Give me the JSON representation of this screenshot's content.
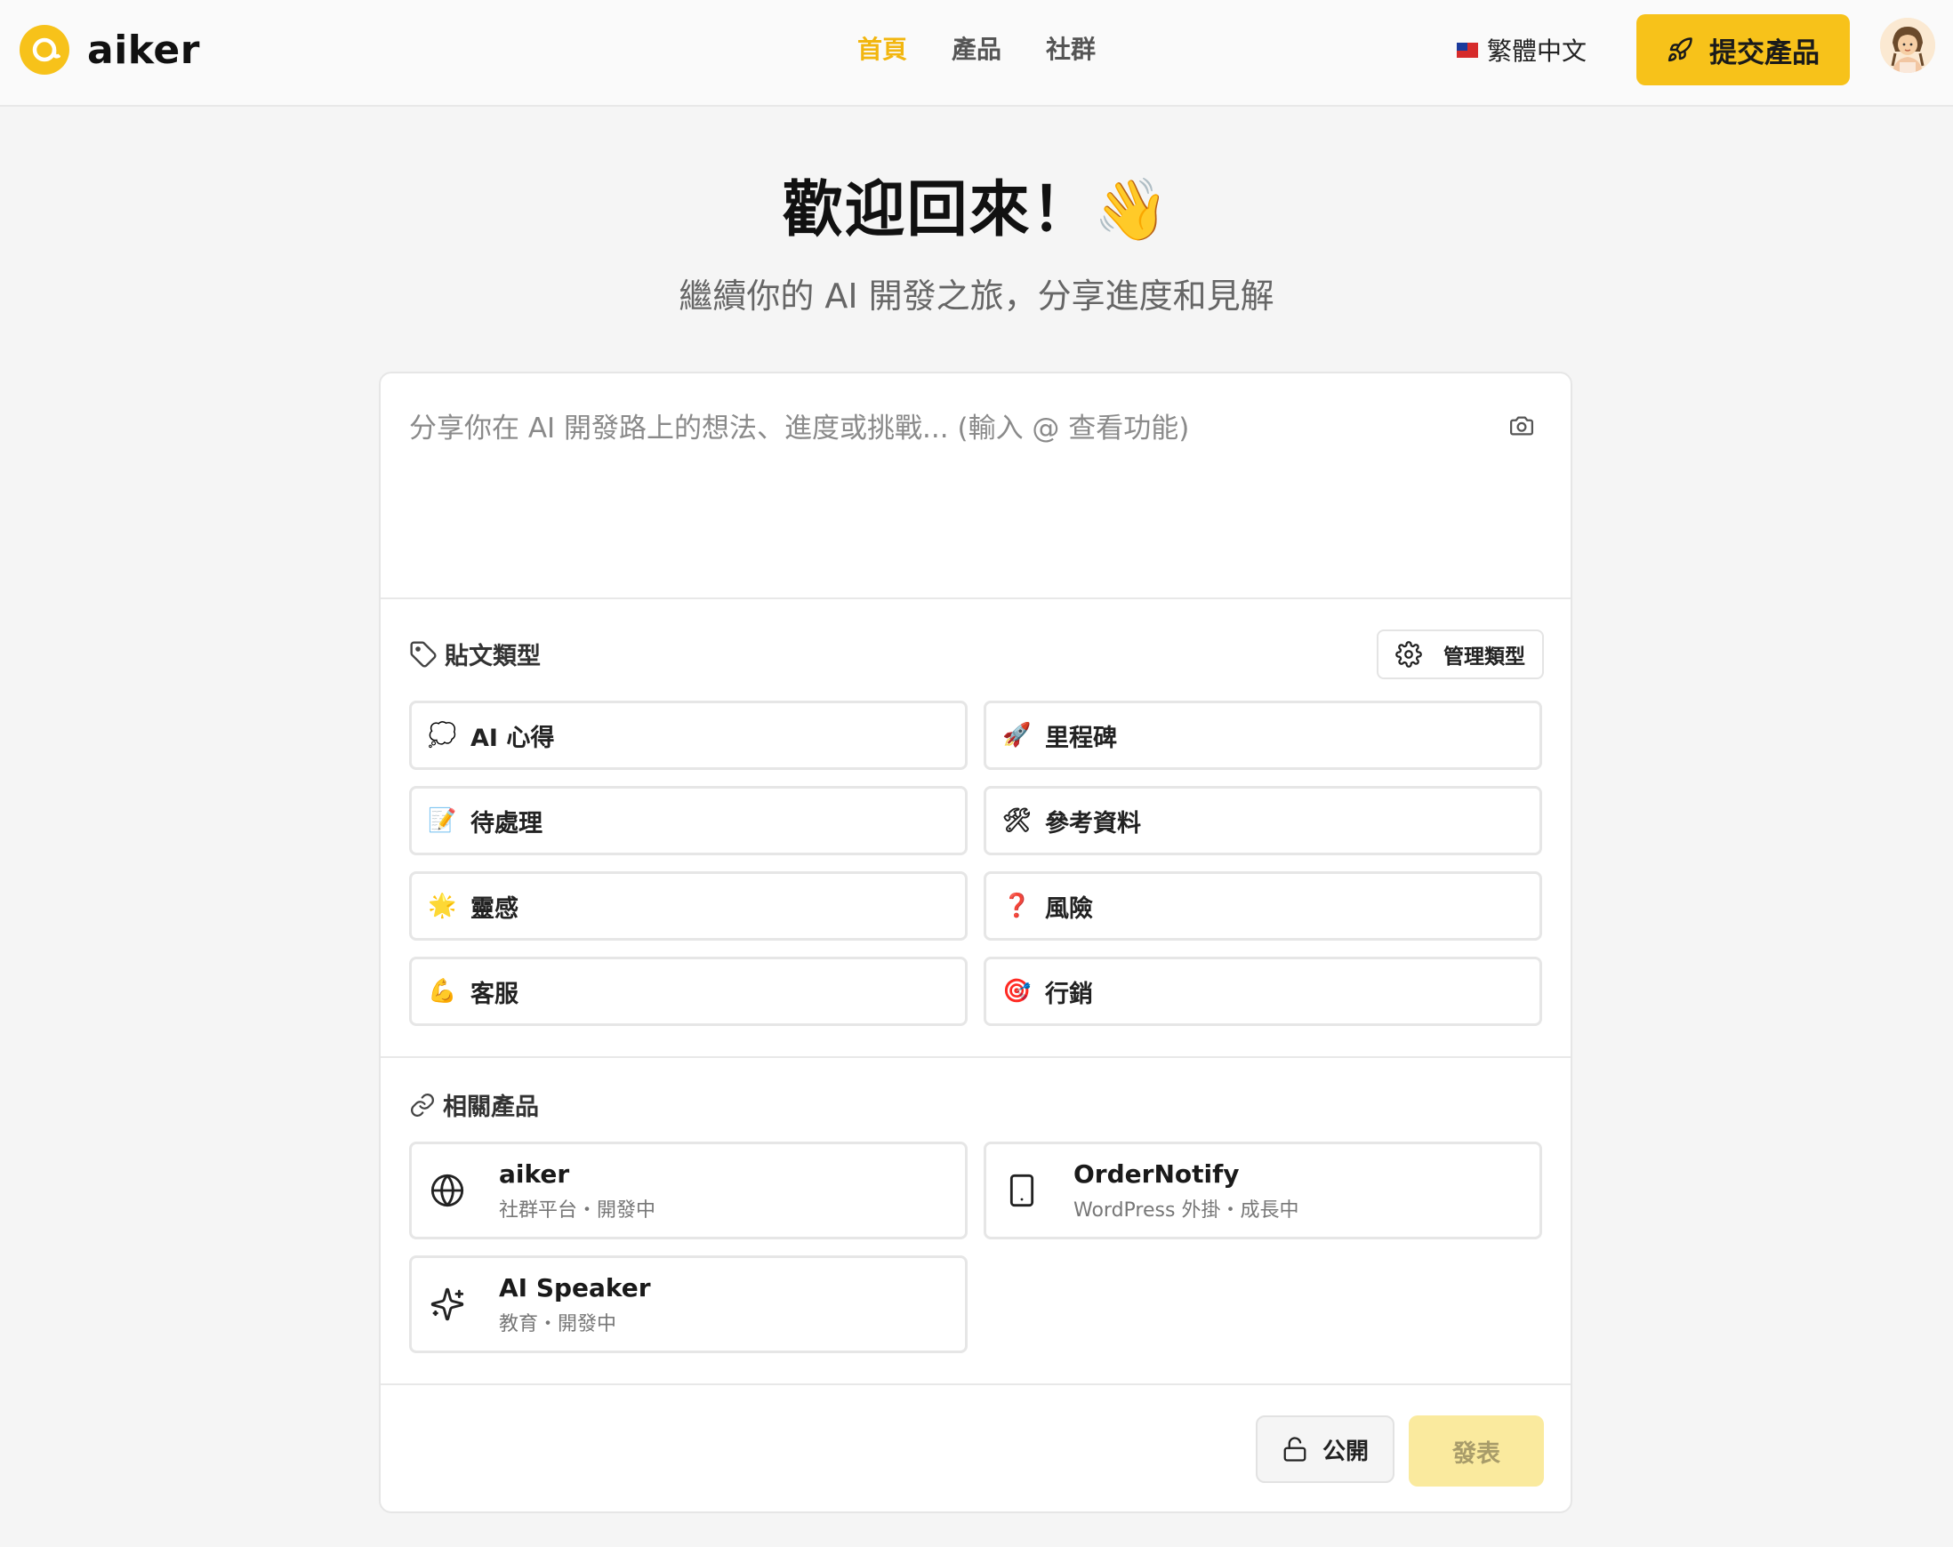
{
  "header": {
    "logo_text": "aiker",
    "nav": [
      {
        "label": "首頁",
        "active": true
      },
      {
        "label": "產品",
        "active": false
      },
      {
        "label": "社群",
        "active": false
      }
    ],
    "language": "繁體中文",
    "submit_label": "提交產品"
  },
  "hero": {
    "title": "歡迎回來！👋",
    "subtitle": "繼續你的 AI 開發之旅，分享進度和見解"
  },
  "composer": {
    "placeholder": "分享你在 AI 開發路上的想法、進度或挑戰... (輸入 @ 查看功能)"
  },
  "post_types": {
    "label": "貼文類型",
    "manage_label": "管理類型",
    "items": [
      {
        "emoji": "💭",
        "label": "AI 心得",
        "icon": "thought-bubble-icon"
      },
      {
        "emoji": "🚀",
        "label": "里程碑",
        "icon": "rocket-icon"
      },
      {
        "emoji": "📝",
        "label": "待處理",
        "icon": "memo-icon"
      },
      {
        "emoji": "🛠",
        "label": "參考資料",
        "icon": "tools-icon"
      },
      {
        "emoji": "🌟",
        "label": "靈感",
        "icon": "glowing-star-icon"
      },
      {
        "emoji": "❓",
        "label": "風險",
        "icon": "question-mark-icon"
      },
      {
        "emoji": "💪",
        "label": "客服",
        "icon": "flexed-biceps-icon"
      },
      {
        "emoji": "🎯",
        "label": "行銷",
        "icon": "target-icon"
      }
    ]
  },
  "related_products": {
    "label": "相關產品",
    "items": [
      {
        "name": "aiker",
        "meta": "社群平台・開發中",
        "icon": "globe-icon"
      },
      {
        "name": "OrderNotify",
        "meta": "WordPress 外掛・成長中",
        "icon": "tablet-icon"
      },
      {
        "name": "AI Speaker",
        "meta": "教育・開發中",
        "icon": "sparkles-icon"
      }
    ]
  },
  "footer": {
    "visibility_label": "公開",
    "post_label": "發表"
  },
  "colors": {
    "accent": "#f7c21a",
    "accent_active_nav": "#f2b60f",
    "post_disabled": "#faea9e"
  }
}
